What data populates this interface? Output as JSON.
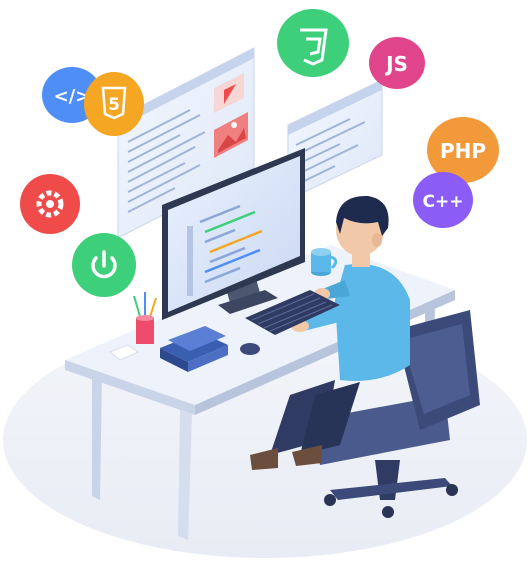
{
  "badges": {
    "code": "</>",
    "html5": "5",
    "js": "JS",
    "php": "PHP",
    "cpp": "C++"
  },
  "icons": {
    "code": "code-brackets-icon",
    "html5": "html5-icon",
    "css3": "css3-icon",
    "js": "javascript-icon",
    "php": "php-icon",
    "cpp": "cpp-icon",
    "gear": "gear-icon",
    "power": "power-icon",
    "play": "play-icon",
    "image": "image-icon"
  },
  "colors": {
    "code_badge": "#4f8ef7",
    "html5_badge": "#f5a623",
    "css3_badge": "#3ecf7a",
    "js_badge": "#e0448b",
    "php_badge": "#f29a3a",
    "cpp_badge": "#8b5cf6",
    "gear_badge": "#ef4b4b",
    "power_badge": "#3ecf7a",
    "shirt": "#5bb8e8",
    "chair": "#3b4a78",
    "desk": "#e8eef8"
  }
}
